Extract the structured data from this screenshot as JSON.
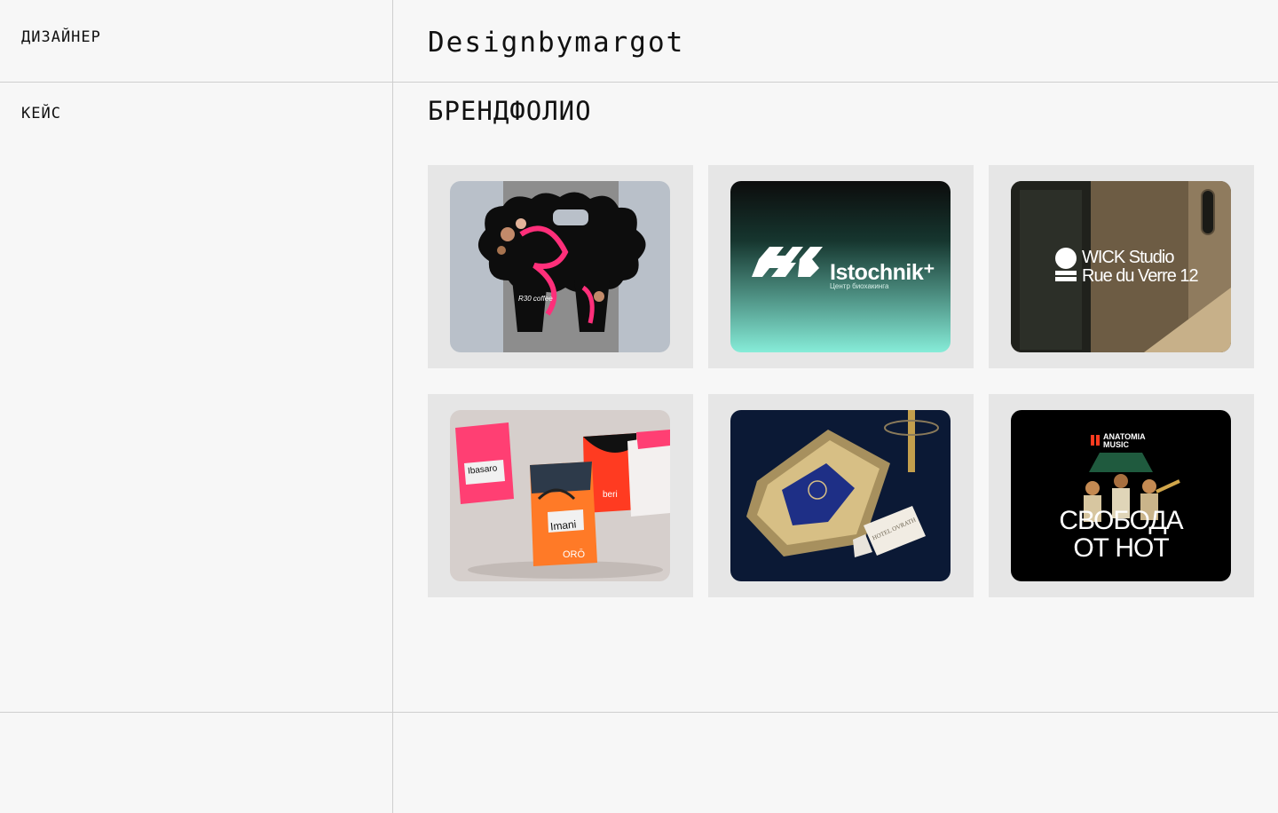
{
  "sidebar": {
    "designer_label": "ДИЗАЙНЕР",
    "case_label": "КЕЙС"
  },
  "header": {
    "site_title": "Designbymargot"
  },
  "main": {
    "section_title": "БРЕНДФОЛИО",
    "cards": [
      {
        "image_icon": "r30-coffee-cup-carrier-image",
        "texts": {
          "cup_label": "R30 coffee"
        }
      },
      {
        "image_icon": "istochnik-logo-image",
        "texts": {
          "name": "Istochnik⁺",
          "subtitle": "Центр биохакинга"
        }
      },
      {
        "image_icon": "wick-studio-door-image",
        "texts": {
          "line1": "WICK Studio",
          "line2": "Rue du Verre 12"
        }
      },
      {
        "image_icon": "oro-coffee-bags-image",
        "texts": {
          "bag1": "Ibasaro",
          "bag2": "Imani",
          "bag3": "beri",
          "brand": "ORŌ"
        }
      },
      {
        "image_icon": "hotel-ovrath-tray-image",
        "texts": {
          "card_label": "HOTEL OVRATH"
        }
      },
      {
        "image_icon": "anatomia-music-poster-image",
        "texts": {
          "brand": "ANATOMIA MUSIC",
          "title1": "СВОБОДА",
          "title2": "ОТ НОТ"
        }
      }
    ]
  },
  "colors": {
    "background": "#f7f7f7",
    "divider": "#cfcfcf",
    "card_bg": "#e6e6e6",
    "text": "#111111"
  }
}
